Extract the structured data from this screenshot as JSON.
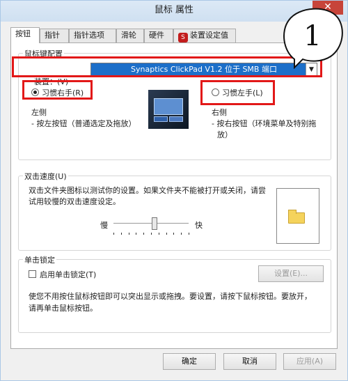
{
  "window": {
    "title": "鼠标 属性",
    "close_symbol": "✕"
  },
  "tabs": [
    {
      "label": "按钮"
    },
    {
      "label": "指针"
    },
    {
      "label": "指针选项"
    },
    {
      "label": "滑轮"
    },
    {
      "label": "硬件"
    },
    {
      "label": "装置设定值"
    }
  ],
  "mouse_config": {
    "group_title": "鼠标键配置",
    "device_label": "装置：(V)",
    "device_value": "Synaptics ClickPad V1.2 位于 SMB 端口",
    "right_hand_label": "习惯右手(R)",
    "left_hand_label": "习惯左手(L)",
    "left_side_title": "左侧",
    "left_side_desc": "- 按左按钮（普通选定及拖放）",
    "right_side_title": "右侧",
    "right_side_desc_1": "- 按右按钮（环境菜单及特别拖",
    "right_side_desc_2": "放）",
    "selected": "right"
  },
  "double_click": {
    "group_title": "双击速度(U)",
    "desc_1": "双击文件夹图标以测试你的设置。如果文件夹不能被打开或关闭，请尝",
    "desc_2": "试用较慢的双击速度设定。",
    "slow_label": "慢",
    "fast_label": "快",
    "speed_fraction": 0.55
  },
  "click_lock": {
    "group_title": "单击锁定",
    "checkbox_label": "启用单击锁定(T)",
    "checked": false,
    "settings_button": "设置(E)...",
    "desc_1": "使您不用按住鼠标按钮即可以突出显示或拖拽。要设置，请按下鼠标按钮。要放开，",
    "desc_2": "请再单击鼠标按钮。"
  },
  "footer": {
    "ok_button": "确定",
    "cancel_button": "取消",
    "apply_button": "应用(A)"
  },
  "annotation": {
    "callout_text": "1"
  },
  "colors": {
    "highlight_red": "#e21818",
    "selection_blue": "#1c6fc9"
  }
}
